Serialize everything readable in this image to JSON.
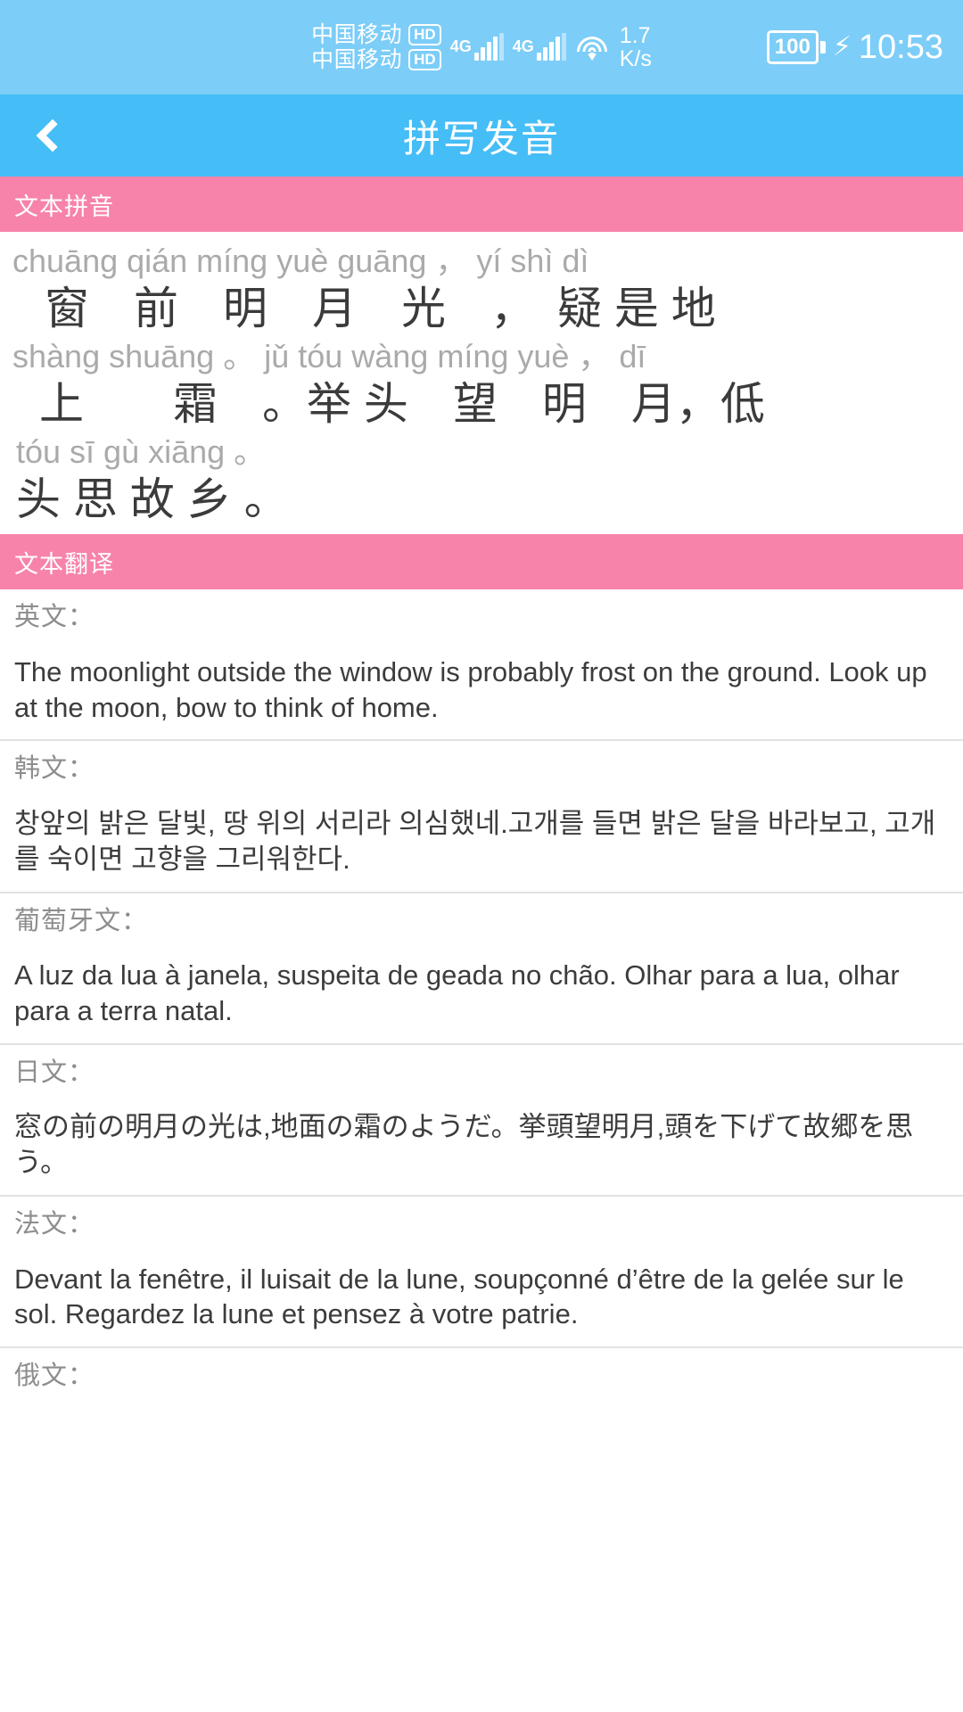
{
  "statusbar": {
    "carrier_1": "中国移动",
    "carrier_2": "中国移动",
    "hd_badge_1": "HD",
    "hd_badge_2": "HD",
    "network_1": "4G",
    "network_2": "4G",
    "net_speed_value": "1.7",
    "net_speed_unit": "K/s",
    "battery_level": "100",
    "charging_icon": "bolt-icon",
    "time": "10:53",
    "wifi_icon": "wifi-icon",
    "signal_icon": "signal-bars-icon"
  },
  "titlebar": {
    "back_icon": "back-chevron-icon",
    "title": "拼写发音"
  },
  "pinyin_section": {
    "header": "文本拼音",
    "rows": [
      {
        "pinyin": "chuāng qián míng yuè guāng ，  yí  shì  dì",
        "hanzi": "窗　前　明　月　光　，　疑 是 地"
      },
      {
        "pinyin": "shàng shuāng 。 jǔ tóu wàng míng yuè ，  dī",
        "hanzi": "上　　霜　。举 头　望　明　月，低"
      },
      {
        "pinyin": "tóu  sī  gù xiāng 。",
        "hanzi": "头 思 故 乡 。"
      }
    ]
  },
  "translation_section": {
    "header": "文本翻译",
    "items": [
      {
        "label": "英文：",
        "text": "The moonlight outside the window is probably frost on the ground. Look up at the moon, bow to think of home."
      },
      {
        "label": "韩文：",
        "text": "창앞의 밝은 달빛, 땅 위의 서리라 의심했네.고개를 들면 밝은 달을 바라보고, 고개를 숙이면 고향을 그리워한다."
      },
      {
        "label": "葡萄牙文：",
        "text": "A luz da lua à janela, suspeita de geada no chão. Olhar para a lua, olhar para a terra natal."
      },
      {
        "label": "日文：",
        "text": "窓の前の明月の光は,地面の霜のようだ。挙頭望明月,頭を下げて故郷を思う。"
      },
      {
        "label": "法文：",
        "text": "Devant la fenêtre, il luisait de la lune, soupçonné d’être de la gelée sur le sol. Regardez la lune et pensez à votre patrie."
      },
      {
        "label": "俄文：",
        "text": ""
      }
    ]
  },
  "colors": {
    "statusbar_blue": "#7ccdf7",
    "titlebar_blue": "#45bdf6",
    "section_pink": "#f783aa",
    "pinyin_gray": "#aaaaaa",
    "hanzi_dark": "#3b3b3b",
    "label_gray": "#8d8d8d",
    "body_dark": "#3c3c3c"
  }
}
